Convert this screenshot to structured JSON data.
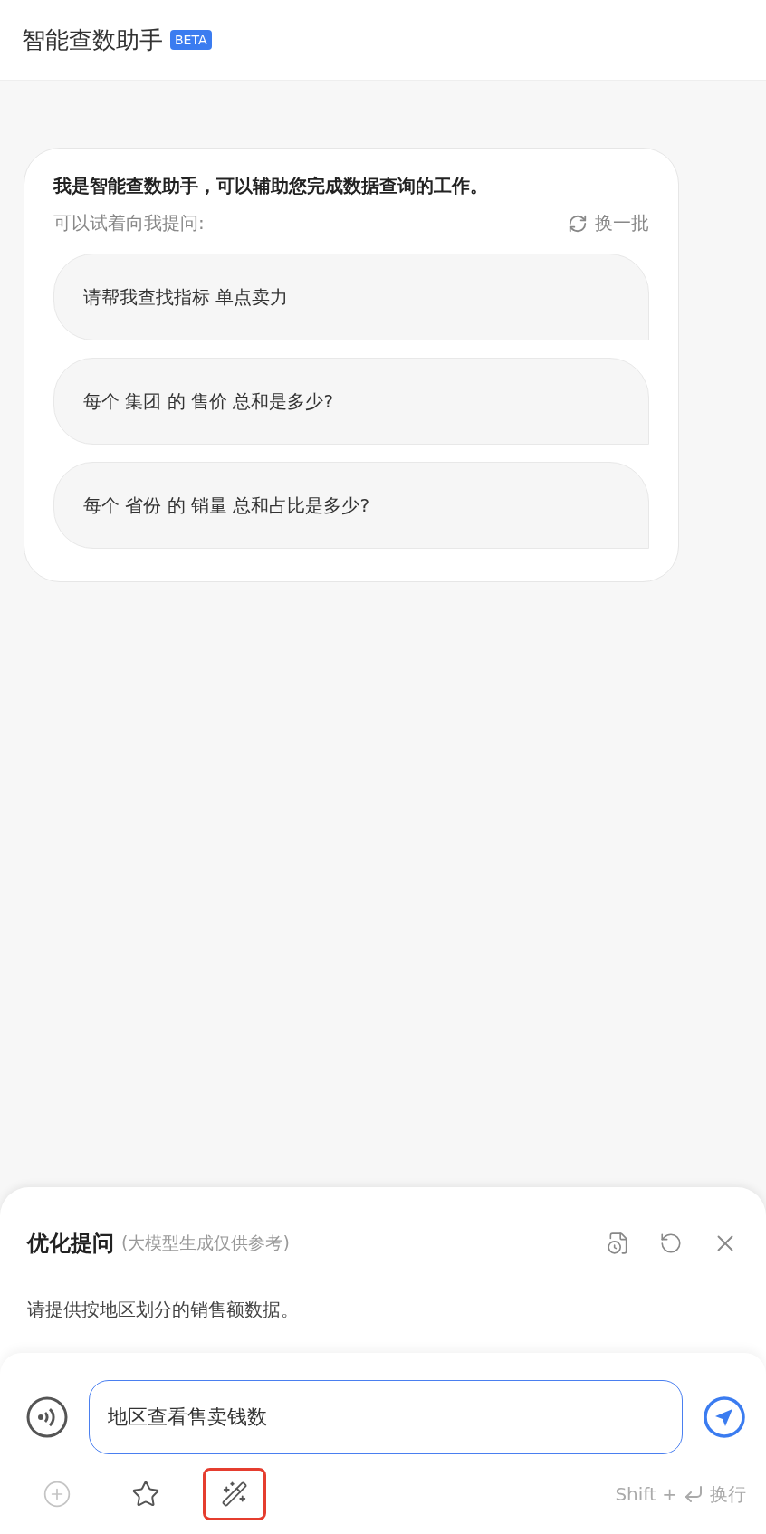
{
  "header": {
    "title": "智能查数助手",
    "badge": "BETA"
  },
  "welcome": {
    "title": "我是智能查数助手，可以辅助您完成数据查询的工作。",
    "prompt_label": "可以试着向我提问:",
    "refresh_label": "换一批",
    "suggestions": [
      "请帮我查找指标 单点卖力",
      "每个 集团 的 售价 总和是多少?",
      "每个 省份 的 销量 总和占比是多少?"
    ]
  },
  "optimize_panel": {
    "title": "优化提问",
    "subtitle": "(大模型生成仅供参考)",
    "result": "请提供按地区划分的销售额数据。"
  },
  "composer": {
    "value": "地区查看售卖钱数",
    "tools": [
      {
        "kind": "add",
        "disabled": true,
        "selected": false
      },
      {
        "kind": "favorite",
        "disabled": false,
        "selected": false
      },
      {
        "kind": "optimize",
        "disabled": false,
        "selected": true
      }
    ],
    "hint_prefix": "Shift +",
    "hint_suffix": "换行"
  }
}
